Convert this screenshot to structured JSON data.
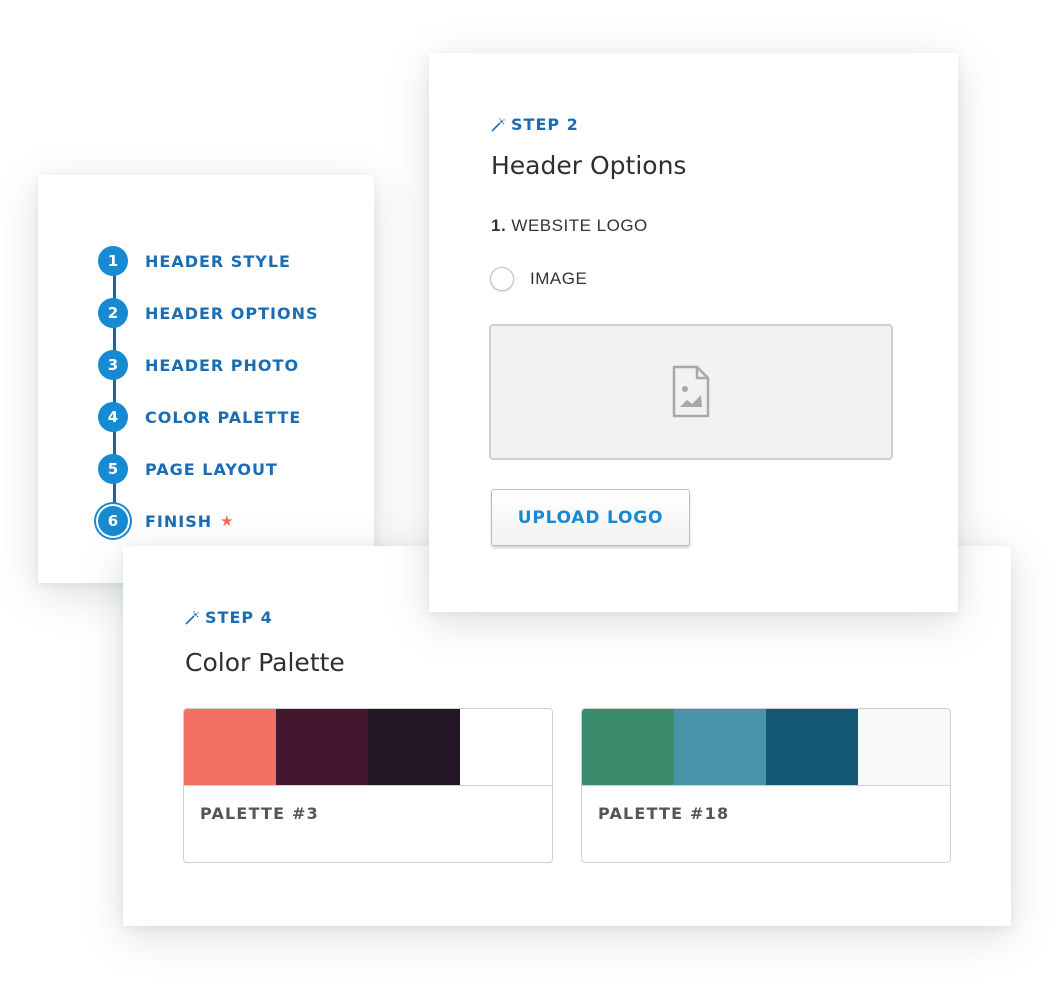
{
  "steps_sidebar": {
    "current_step": 6,
    "steps": [
      {
        "number": "1",
        "label": "HEADER STYLE"
      },
      {
        "number": "2",
        "label": "HEADER OPTIONS"
      },
      {
        "number": "3",
        "label": "HEADER PHOTO"
      },
      {
        "number": "4",
        "label": "COLOR PALETTE"
      },
      {
        "number": "5",
        "label": "PAGE LAYOUT"
      },
      {
        "number": "6",
        "label": "FINISH",
        "badge_icon": "star-icon"
      }
    ]
  },
  "header_options_card": {
    "step_tag": "STEP 2",
    "step_icon": "magic-wand-icon",
    "title": "Header Options",
    "field_number": "1.",
    "field_label": "WEBSITE LOGO",
    "radio_option": {
      "label": "IMAGE",
      "checked": false
    },
    "dropzone_icon": "image-file-icon",
    "upload_button_label": "UPLOAD LOGO"
  },
  "color_palette_card": {
    "step_tag": "STEP 4",
    "step_icon": "magic-wand-icon",
    "title": "Color Palette",
    "palettes": [
      {
        "name": "PALETTE #3",
        "colors": [
          "#f26f63",
          "#43182e",
          "#231726",
          "#ffffff"
        ]
      },
      {
        "name": "PALETTE #18",
        "colors": [
          "#3b8b6d",
          "#4893a8",
          "#135773",
          "#f7f8f8"
        ]
      }
    ]
  },
  "colors": {
    "accent_blue": "#168ad3",
    "step_text_blue": "#1a6db3",
    "star_red": "#ef6b5f"
  }
}
